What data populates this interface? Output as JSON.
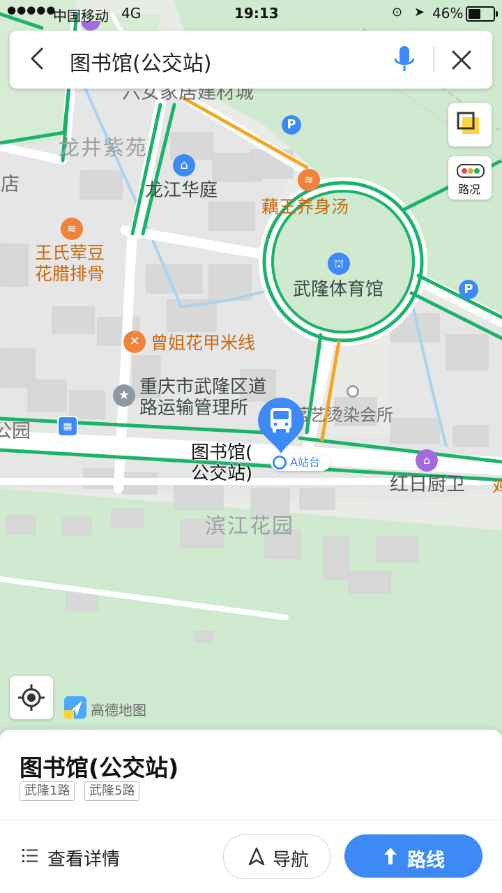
{
  "status_bar": {
    "signal": "●●●●●",
    "carrier": "中国移动",
    "network": "4G",
    "time": "19:13",
    "battery": "46%"
  },
  "search": {
    "title": "图书馆(公交站)"
  },
  "map_controls": {
    "traffic_label": "路况"
  },
  "map_labels": {
    "liuyi": "六女家居建材城",
    "longjing": "龙井紫苑",
    "jiudian": "酒店",
    "longjiang": "龙江华庭",
    "ouwang": "藕王养身汤",
    "wangshi": "王氏荤豆\n花腊排骨",
    "wulong_stadium": "武隆体育馆",
    "zengjie": "曾姐花甲米线",
    "transport": "重庆市武隆区道\n路运输管理所",
    "mingyi": "茗艺烫染会所",
    "left_edge": "公园",
    "station": "图书馆(\n公交站)",
    "platform": "A站台",
    "hongri": "红日厨卫",
    "right_edge": "鸡",
    "binjiang": "滨江花园",
    "brand": "高德地图"
  },
  "panel": {
    "title": "图书馆(公交站)",
    "routes": [
      "武隆1路",
      "武隆5路"
    ],
    "details_label": "查看详情",
    "navigate_label": "导航",
    "route_label": "路线"
  },
  "colors": {
    "accent": "#3d8af7",
    "road_green": "#19b36b",
    "road_orange": "#f5a623",
    "green_area": "#cfeacf",
    "block": "#dcdcdc"
  }
}
